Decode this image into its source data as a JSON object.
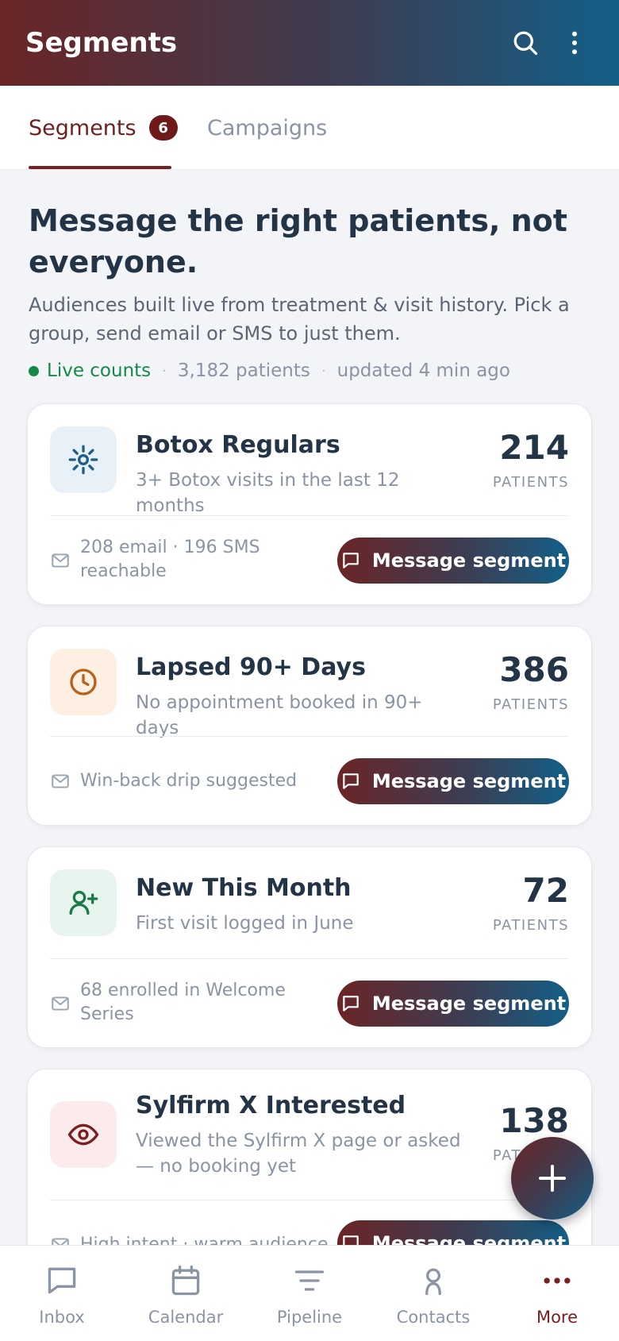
{
  "appbar": {
    "title": "Segments",
    "actions": [
      "search-icon",
      "more-vertical-icon"
    ]
  },
  "tabs": [
    {
      "label": "Segments",
      "badge": "6",
      "active": true
    },
    {
      "label": "Campaigns",
      "active": false
    }
  ],
  "hero": {
    "title": "Message the right patients, not everyone.",
    "subtitle": "Audiences built live from treatment & visit history. Pick a group, send email or SMS to just them."
  },
  "live": {
    "label": "Live counts",
    "patients": "3,182 patients",
    "updated": "updated 4 min ago"
  },
  "segments": [
    {
      "title": "Botox Regulars",
      "description": "3+ Botox visits in the last 12 months",
      "count": "214",
      "unit": "PATIENTS",
      "footer": "208 email · 196 SMS reachable",
      "button": "Message segment",
      "icon": "sparkle-icon",
      "icon_bg": "#e8f1f8",
      "icon_color": "#1f5f86"
    },
    {
      "title": "Lapsed 90+ Days",
      "description": "No appointment booked in 90+ days",
      "count": "386",
      "unit": "PATIENTS",
      "footer": "Win-back drip suggested",
      "button": "Message segment",
      "icon": "clock-icon",
      "icon_bg": "#fdf0e3",
      "icon_color": "#b5621b"
    },
    {
      "title": "New This Month",
      "description": "First visit logged in June",
      "count": "72",
      "unit": "PATIENTS",
      "footer": "68 enrolled in Welcome Series",
      "button": "Message segment",
      "icon": "user-plus-icon",
      "icon_bg": "#e8f5ee",
      "icon_color": "#1a7a48"
    },
    {
      "title": "Sylfirm X Interested",
      "description": "Viewed the Sylfirm X page or asked — no booking yet",
      "count": "138",
      "unit": "PATIENTS",
      "footer": "High intent · warm audience",
      "button": "Message segment",
      "icon": "eye-icon",
      "icon_bg": "#fcebec",
      "icon_color": "#7a1f1f"
    }
  ],
  "fab": {
    "icon": "plus-icon"
  },
  "bottom_nav": [
    {
      "label": "Inbox",
      "icon": "chat-icon",
      "active": false
    },
    {
      "label": "Calendar",
      "icon": "calendar-icon",
      "active": false
    },
    {
      "label": "Pipeline",
      "icon": "filter-icon",
      "active": false
    },
    {
      "label": "Contacts",
      "icon": "person-icon",
      "active": false
    },
    {
      "label": "More",
      "icon": "more-horizontal-icon",
      "active": true
    }
  ],
  "colors": {
    "accent": "#7a1f1f",
    "gradient_start": "#6a2526",
    "gradient_end": "#135f88",
    "live_green": "#16884a"
  }
}
